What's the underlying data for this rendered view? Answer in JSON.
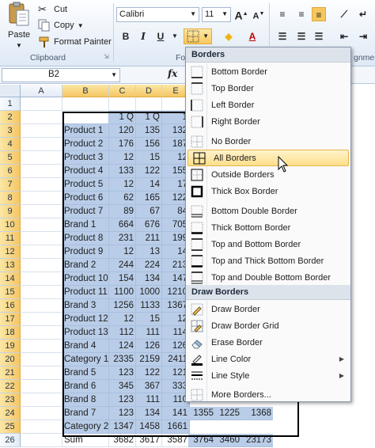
{
  "ribbon": {
    "clipboard": {
      "paste": "Paste",
      "cut": "Cut",
      "copy": "Copy",
      "format_painter": "Format Painter",
      "group_label": "Clipboard"
    },
    "font": {
      "name": "Calibri",
      "size": "11",
      "group_label": "Fo"
    },
    "alignment": {
      "group_label": "gnmen"
    }
  },
  "formula_bar": {
    "name_box": "B2",
    "fx": "fx"
  },
  "columns": [
    "A",
    "B",
    "C",
    "D",
    "E"
  ],
  "rows": [
    "1",
    "2",
    "3",
    "4",
    "5",
    "6",
    "7",
    "8",
    "9",
    "10",
    "11",
    "12",
    "13",
    "14",
    "15",
    "16",
    "17",
    "18",
    "19",
    "20",
    "21",
    "22",
    "23",
    "24",
    "25",
    "26"
  ],
  "table": {
    "header": [
      "",
      "1 Q",
      "1 Q",
      "1"
    ],
    "rows": [
      [
        "Product 1",
        "120",
        "135",
        "132"
      ],
      [
        "Product 2",
        "176",
        "156",
        "187"
      ],
      [
        "Product 3",
        "12",
        "15",
        "12"
      ],
      [
        "Product 4",
        "133",
        "122",
        "155"
      ],
      [
        "Product 5",
        "12",
        "14",
        "17"
      ],
      [
        "Product 6",
        "62",
        "165",
        "122"
      ],
      [
        "Product 7",
        "89",
        "67",
        "84"
      ],
      [
        "Brand 1",
        "664",
        "676",
        "705"
      ],
      [
        "Product 8",
        "231",
        "211",
        "199"
      ],
      [
        "Product 9",
        "12",
        "13",
        "14"
      ],
      [
        "Brand 2",
        "244",
        "224",
        "213"
      ],
      [
        "Product 10",
        "154",
        "134",
        "147"
      ],
      [
        "Product 11",
        "1100",
        "1000",
        "1210"
      ],
      [
        "Brand 3",
        "1256",
        "1133",
        "1367"
      ],
      [
        "Product 12",
        "12",
        "15",
        "12"
      ],
      [
        "Product 13",
        "112",
        "111",
        "114"
      ],
      [
        "Brand 4",
        "124",
        "126",
        "126"
      ],
      [
        "Category 1",
        "2335",
        "2159",
        "2411"
      ],
      [
        "Brand 5",
        "123",
        "122",
        "121"
      ],
      [
        "Brand 6",
        "345",
        "367",
        "333"
      ],
      [
        "Brand 8",
        "123",
        "111",
        "110"
      ],
      [
        "Brand 7",
        "123",
        "134",
        "141"
      ],
      [
        "Category 2",
        "1347",
        "1458",
        "1661"
      ],
      [
        "Sum",
        "3682",
        "3617",
        "3587"
      ]
    ],
    "row23_extra": [
      "1355",
      "1225",
      "1368"
    ],
    "row25_extra": [
      "3764",
      "3460",
      "23173"
    ]
  },
  "menu": {
    "header_borders": "Borders",
    "items": [
      {
        "label": "Bottom Border",
        "icon": "bottom-border-icon"
      },
      {
        "label": "Top Border",
        "icon": "top-border-icon"
      },
      {
        "label": "Left Border",
        "icon": "left-border-icon"
      },
      {
        "label": "Right Border",
        "icon": "right-border-icon"
      },
      {
        "label": "No Border",
        "icon": "no-border-icon"
      },
      {
        "label": "All Borders",
        "icon": "all-borders-icon"
      },
      {
        "label": "Outside Borders",
        "icon": "outside-borders-icon"
      },
      {
        "label": "Thick Box Border",
        "icon": "thick-box-border-icon"
      },
      {
        "label": "Bottom Double Border",
        "icon": "bottom-double-border-icon"
      },
      {
        "label": "Thick Bottom Border",
        "icon": "thick-bottom-border-icon"
      },
      {
        "label": "Top and Bottom Border",
        "icon": "top-bottom-border-icon"
      },
      {
        "label": "Top and Thick Bottom Border",
        "icon": "top-thick-bottom-border-icon"
      },
      {
        "label": "Top and Double Bottom Border",
        "icon": "top-double-bottom-border-icon"
      }
    ],
    "header_draw": "Draw Borders",
    "draw_items": [
      {
        "label": "Draw Border",
        "icon": "pencil-icon"
      },
      {
        "label": "Draw Border Grid",
        "icon": "pencil-grid-icon"
      },
      {
        "label": "Erase Border",
        "icon": "eraser-icon"
      },
      {
        "label": "Line Color",
        "icon": "line-color-icon",
        "submenu": true
      },
      {
        "label": "Line Style",
        "icon": "line-style-icon",
        "submenu": true
      },
      {
        "label": "More Borders...",
        "icon": "more-borders-icon"
      }
    ],
    "highlighted": "All Borders"
  },
  "colors": {
    "selection": "#b9cde8",
    "highlight": "#fde08a",
    "header_selected": "#f5c663"
  }
}
